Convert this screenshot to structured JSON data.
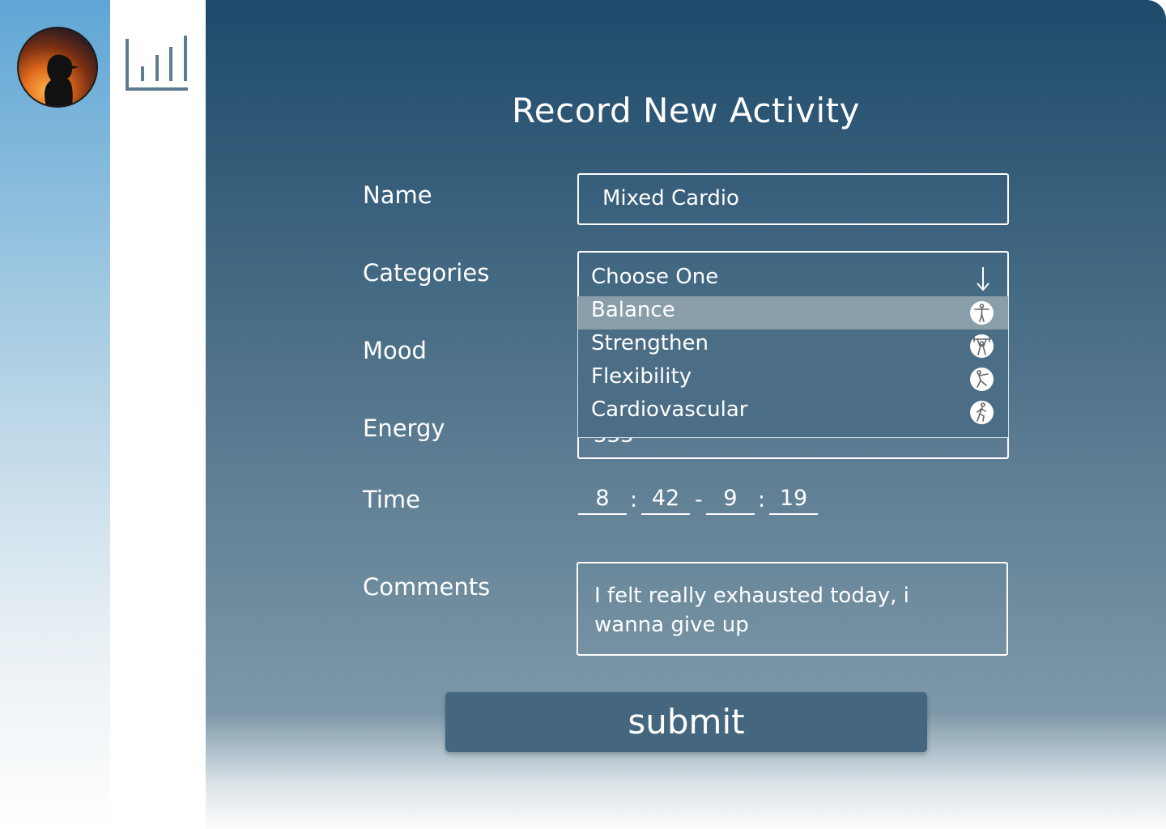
{
  "form": {
    "title": "Record New Activity",
    "name": {
      "label": "Name",
      "value": "Mixed Cardio"
    },
    "categories": {
      "label": "Categories",
      "placeholder": "Choose One",
      "options": [
        {
          "label": "Balance",
          "icon": "balance-icon",
          "selected": true
        },
        {
          "label": "Strengthen",
          "icon": "weightlifting-icon",
          "selected": false
        },
        {
          "label": "Flexibility",
          "icon": "stretching-icon",
          "selected": false
        },
        {
          "label": "Cardiovascular",
          "icon": "running-icon",
          "selected": false
        }
      ]
    },
    "mood": {
      "label": "Mood"
    },
    "energy": {
      "label": "Energy",
      "value": "333"
    },
    "time": {
      "label": "Time",
      "start_hour": "8",
      "start_minute": "42",
      "end_hour": "9",
      "end_minute": "19",
      "separator": ":",
      "range_separator": "-"
    },
    "comments": {
      "label": "Comments",
      "value": "I felt really exhausted today, i wanna give up"
    },
    "submit_label": "submit"
  },
  "colors": {
    "panel_top": "#1e4a6b",
    "panel_bottom": "#7d98a8",
    "rail_top": "#5fa6d5",
    "button": "#44677f",
    "dropdown_bg": "#4b6d85",
    "selected_option": "#8a9ea9"
  }
}
